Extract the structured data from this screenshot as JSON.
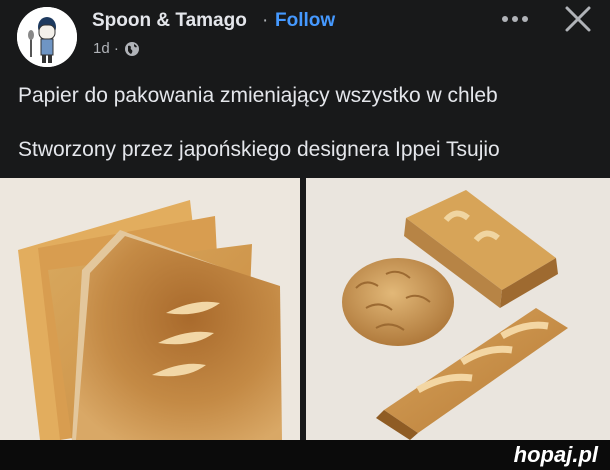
{
  "post": {
    "author": "Spoon & Tamago",
    "separator": "·",
    "follow_label": "Follow",
    "time": "1d ·",
    "icons": {
      "privacy": "globe-icon",
      "more": "more-horizontal-icon",
      "close": "close-icon"
    },
    "text_line1": "Papier do pakowania zmieniający wszystko w chleb",
    "text_line2": "Stworzony przez japońskiego designera Ippei Tsujio"
  },
  "images": [
    {
      "name": "bread-paper-sheets-photo"
    },
    {
      "name": "wrapped-bread-objects-photo"
    }
  ],
  "watermark": {
    "text": "hopaj.pl"
  },
  "colors": {
    "background": "#18191a",
    "follow": "#4599ff",
    "text": "#e4e6eb",
    "muted": "#b0b3b8"
  }
}
